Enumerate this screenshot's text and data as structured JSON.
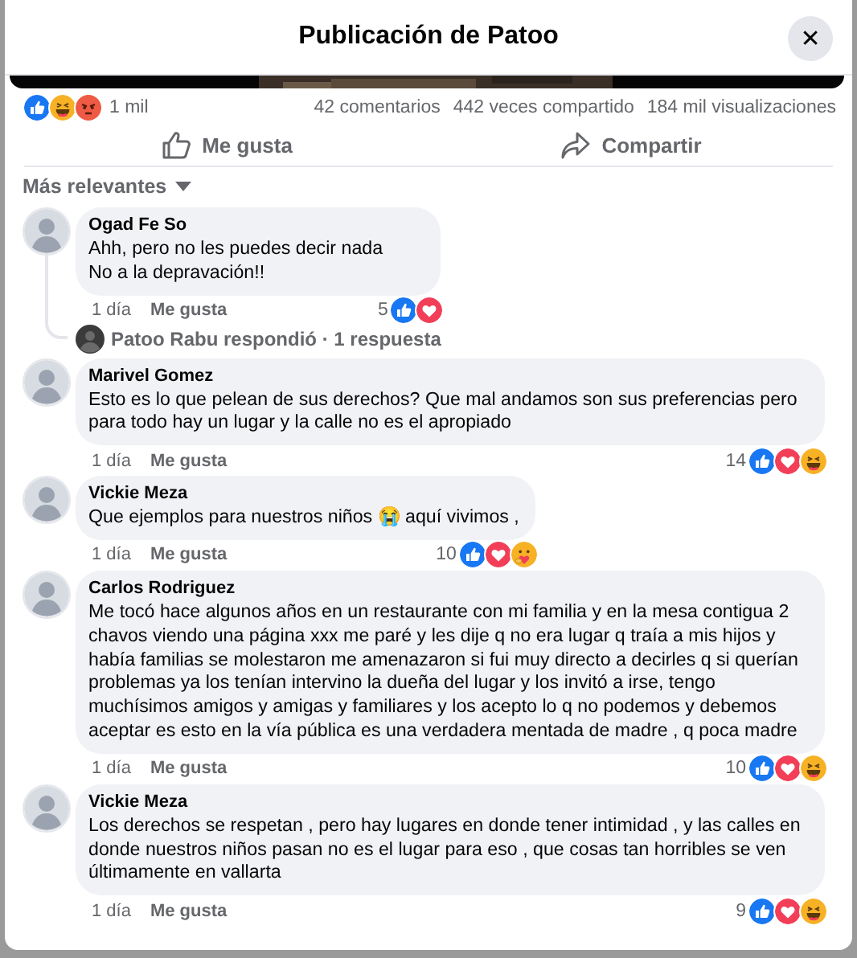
{
  "dialog": {
    "title": "Publicación de Patoo",
    "close": "✕"
  },
  "post": {
    "reactions": [
      {
        "kind": "like"
      },
      {
        "kind": "haha"
      },
      {
        "kind": "angry"
      }
    ],
    "reaction_count": "1 mil",
    "stats": [
      "42 comentarios",
      "442 veces compartido",
      "184 mil visualizaciones"
    ],
    "actions": [
      {
        "kind": "like",
        "label": "Me gusta"
      },
      {
        "kind": "share",
        "label": "Compartir"
      }
    ]
  },
  "sort": {
    "label": "Más relevantes"
  },
  "comments": [
    {
      "author": "Ogad Fe So",
      "text": "Ahh, pero no les puedes decir nada\nNo a la depravación!!",
      "time": "1 día",
      "like_label": "Me gusta",
      "reaction_count": "5",
      "reactions": [
        {
          "kind": "like"
        },
        {
          "kind": "love"
        }
      ],
      "reply": {
        "text": "Patoo Rabu respondió · 1 respuesta"
      }
    },
    {
      "author": "Marivel Gomez",
      "text": "Esto es lo que pelean de sus derechos? Que mal andamos son sus preferencias pero para todo hay un lugar y la calle no es el apropiado",
      "time": "1 día",
      "like_label": "Me gusta",
      "reaction_count": "14",
      "reactions": [
        {
          "kind": "like"
        },
        {
          "kind": "love"
        },
        {
          "kind": "haha"
        }
      ]
    },
    {
      "author": "Vickie Meza",
      "text": "Que ejemplos para nuestros niños 😭 aquí vivimos ,",
      "time": "1 día",
      "like_label": "Me gusta",
      "reaction_count": "10",
      "reactions": [
        {
          "kind": "like"
        },
        {
          "kind": "love"
        },
        {
          "kind": "care"
        }
      ]
    },
    {
      "author": "Carlos Rodriguez",
      "text": "Me tocó hace algunos años en un restaurante con mi familia y en la mesa contigua 2 chavos viendo una página xxx me paré y les dije q no era lugar q traía a mis hijos y había familias se molestaron me amenazaron si fui muy directo a decirles q si querían problemas ya los tenían intervino la dueña del lugar y los invitó a irse, tengo muchísimos amigos y amigas y familiares y los acepto lo q no podemos y debemos aceptar es esto en la vía pública es una verdadera mentada de madre , q poca madre",
      "time": "1 día",
      "like_label": "Me gusta",
      "reaction_count": "10",
      "reactions": [
        {
          "kind": "like"
        },
        {
          "kind": "love"
        },
        {
          "kind": "haha"
        }
      ]
    },
    {
      "author": "Vickie Meza",
      "text": "Los derechos se respetan , pero hay lugares en donde tener intimidad , y las calles en donde nuestros niños pasan no es el lugar para eso , que cosas tan horribles se ven últimamente en vallarta",
      "time": "1 día",
      "like_label": "Me gusta",
      "reaction_count": "9",
      "reactions": [
        {
          "kind": "like"
        },
        {
          "kind": "love"
        },
        {
          "kind": "haha"
        }
      ]
    }
  ]
}
